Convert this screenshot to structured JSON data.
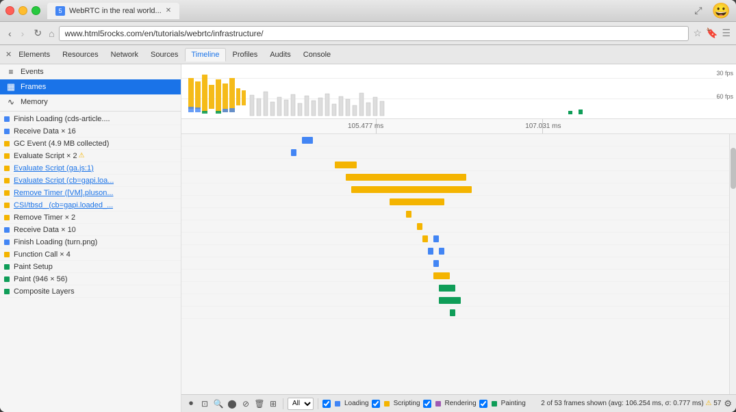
{
  "browser": {
    "tab_title": "WebRTC in the real world...",
    "tab_favicon": "5",
    "url": "www.html5rocks.com/en/tutorials/webrtc/infrastructure/",
    "emoji": "😀"
  },
  "devtools": {
    "tabs": [
      {
        "label": "Elements",
        "active": false
      },
      {
        "label": "Resources",
        "active": false
      },
      {
        "label": "Network",
        "active": false
      },
      {
        "label": "Sources",
        "active": false
      },
      {
        "label": "Timeline",
        "active": true
      },
      {
        "label": "Profiles",
        "active": false
      },
      {
        "label": "Audits",
        "active": false
      },
      {
        "label": "Console",
        "active": false
      }
    ],
    "sidebar": {
      "items": [
        {
          "label": "Events",
          "icon": "≡",
          "active": false
        },
        {
          "label": "Frames",
          "icon": "▦",
          "active": true
        },
        {
          "label": "Memory",
          "icon": "∿",
          "active": false
        }
      ]
    },
    "events": [
      {
        "label": "Finish Loading (cds-article....",
        "color": "blue",
        "warning": false
      },
      {
        "label": "Receive Data × 16",
        "color": "blue",
        "warning": false
      },
      {
        "label": "GC Event (4.9 MB collected)",
        "color": "orange",
        "warning": false
      },
      {
        "label": "Evaluate Script × 2",
        "color": "orange",
        "warning": true
      },
      {
        "label": "Evaluate Script (ga.js:1)",
        "color": "orange",
        "warning": false
      },
      {
        "label": "Evaluate Script (cb=gapi.loa...",
        "color": "orange",
        "warning": false
      },
      {
        "label": "Remove Timer ([VM].pluson...",
        "color": "orange",
        "warning": false
      },
      {
        "label": "CSI/tbsd_ (cb=gapi.loaded_...",
        "color": "orange",
        "warning": false
      },
      {
        "label": "Remove Timer × 2",
        "color": "orange",
        "warning": false
      },
      {
        "label": "Receive Data × 10",
        "color": "blue",
        "warning": false
      },
      {
        "label": "Finish Loading (turn.png)",
        "color": "blue",
        "warning": false
      },
      {
        "label": "Function Call × 4",
        "color": "orange",
        "warning": false
      },
      {
        "label": "Paint Setup",
        "color": "green",
        "warning": false
      },
      {
        "label": "Paint (946 × 56)",
        "color": "green",
        "warning": false
      },
      {
        "label": "Composite Layers",
        "color": "green",
        "warning": false
      }
    ],
    "ruler": {
      "marker1": "105.477 ms",
      "marker2": "107.031 ms"
    },
    "fps_labels": {
      "fps30": "30 fps",
      "fps60": "60 fps"
    },
    "bottom": {
      "filter_all": "All",
      "filter_loading": "Loading",
      "filter_scripting": "Scripting",
      "filter_rendering": "Rendering",
      "filter_painting": "Painting",
      "status": "2 of 53 frames shown (avg: 106.254 ms, σ: 0.777 ms)",
      "warning_count": "57"
    }
  }
}
